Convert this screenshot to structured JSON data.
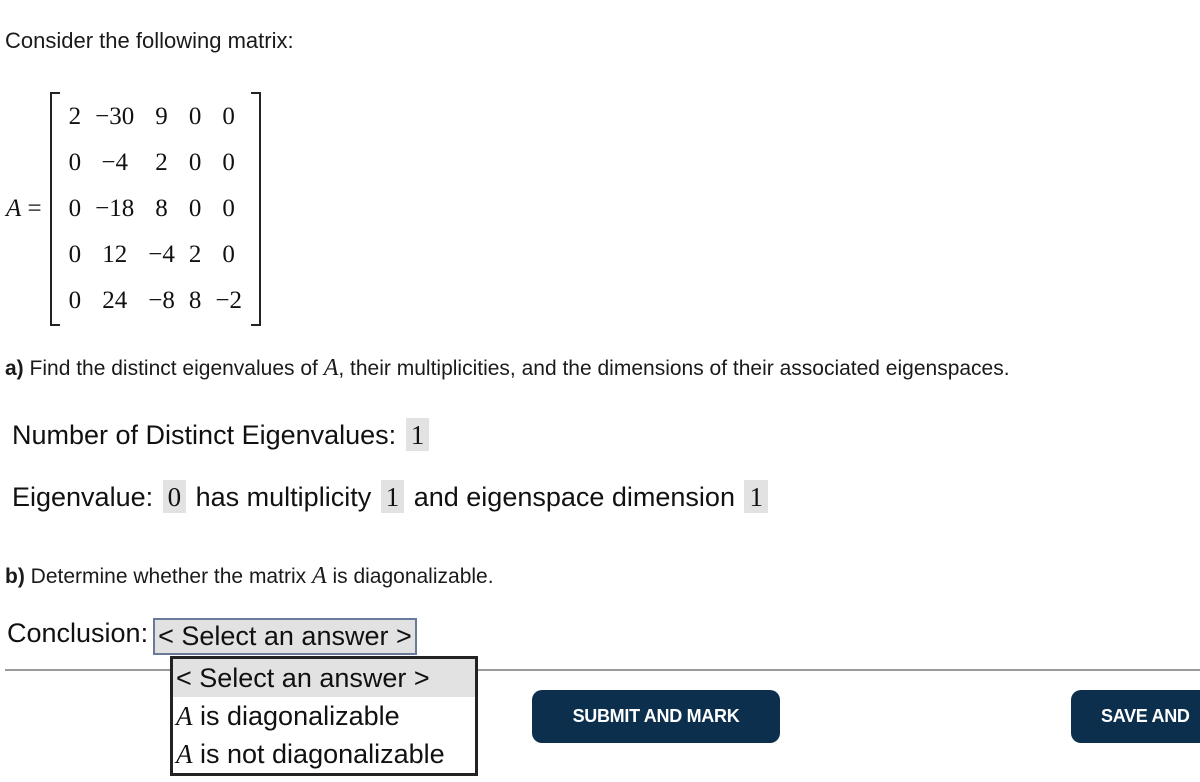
{
  "intro": "Consider the following matrix:",
  "matrix": {
    "label": "A",
    "equals": "=",
    "rows": [
      [
        "2",
        "−30",
        "9",
        "0",
        "0"
      ],
      [
        "0",
        "−4",
        "2",
        "0",
        "0"
      ],
      [
        "0",
        "−18",
        "8",
        "0",
        "0"
      ],
      [
        "0",
        "12",
        "−4",
        "2",
        "0"
      ],
      [
        "0",
        "24",
        "−8",
        "8",
        "−2"
      ]
    ]
  },
  "part_a": {
    "label": "a)",
    "text_before": " Find the distinct eigenvalues of ",
    "var": "A",
    "text_after": ", their multiplicities, and the dimensions of their associated eigenspaces."
  },
  "distinct": {
    "label": "Number of Distinct Eigenvalues:",
    "value": "1"
  },
  "eigen": {
    "label": "Eigenvalue:",
    "value": "0",
    "mult_label": "has multiplicity",
    "mult_value": "1",
    "dim_label": "and eigenspace dimension",
    "dim_value": "1"
  },
  "part_b": {
    "label": "b)",
    "text_before": " Determine whether the matrix ",
    "var": "A",
    "text_after": " is diagonalizable."
  },
  "conclusion": {
    "label": "Conclusion:",
    "selected": "< Select an answer >",
    "options": [
      {
        "var": "",
        "text": "< Select an answer >"
      },
      {
        "var": "A",
        "text": " is diagonalizable"
      },
      {
        "var": "A",
        "text": " is not diagonalizable"
      }
    ]
  },
  "buttons": {
    "submit": "SUBMIT AND MARK",
    "save": "SAVE AND"
  }
}
